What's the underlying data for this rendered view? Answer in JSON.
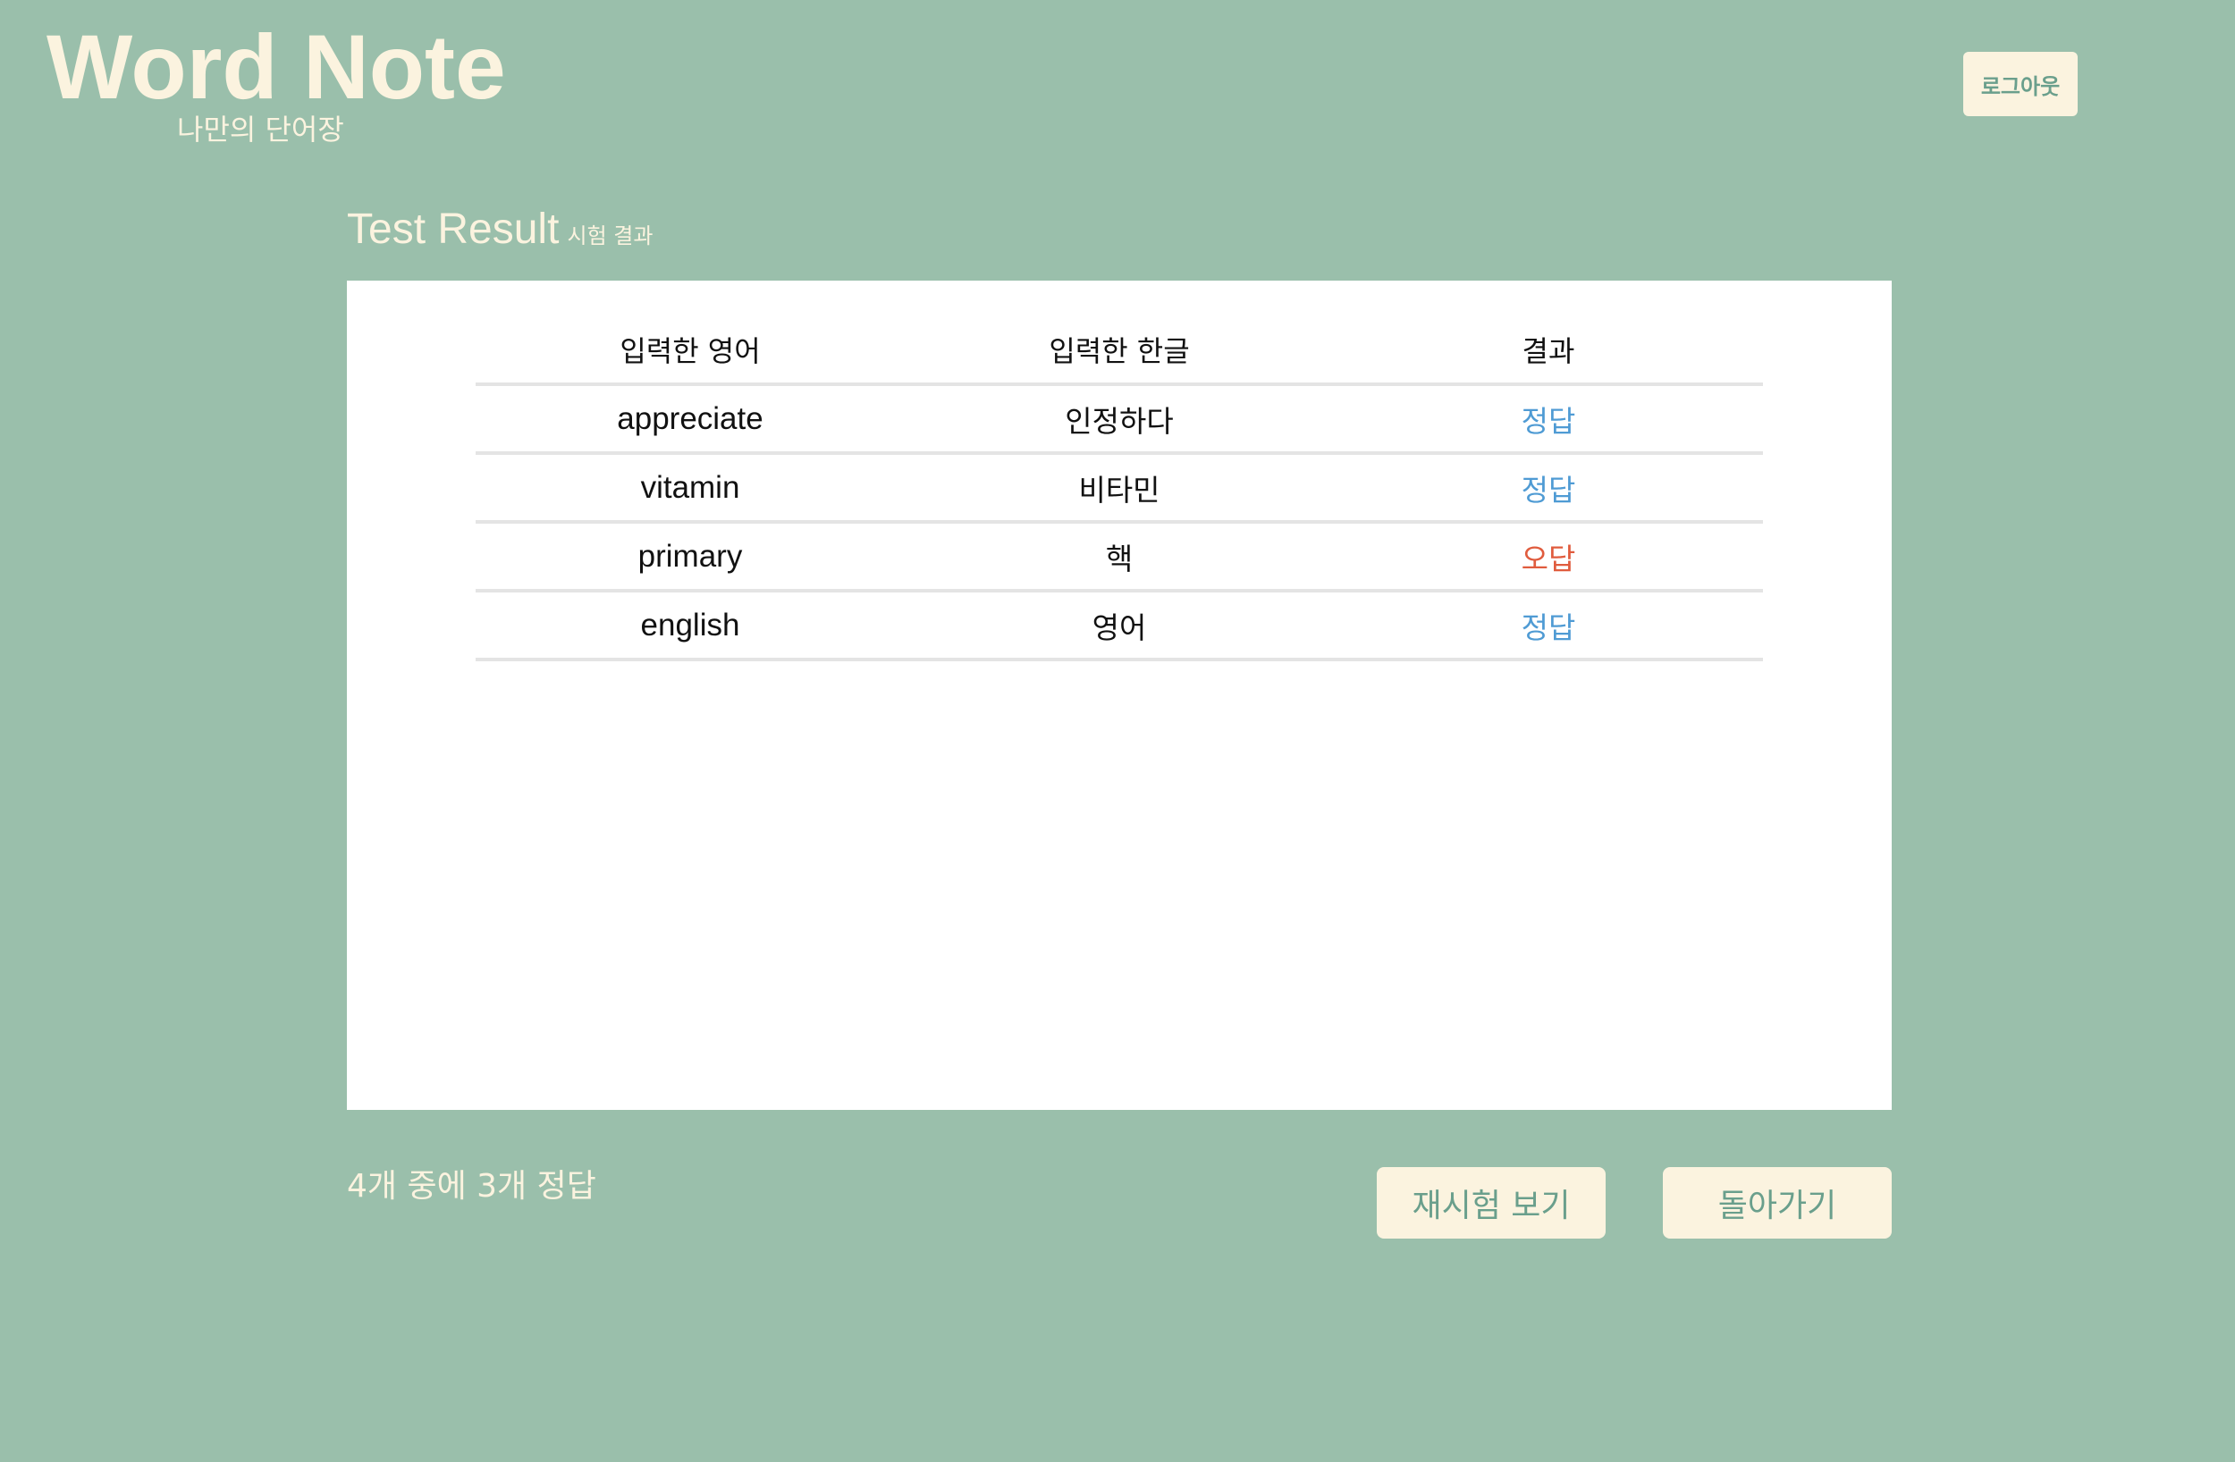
{
  "header": {
    "title": "Word Note",
    "subtitle": "나만의 단어장",
    "logout_label": "로그아웃"
  },
  "page": {
    "title": "Test Result",
    "subtitle": "시험 결과"
  },
  "table": {
    "columns": [
      "입력한 영어",
      "입력한 한글",
      "결과"
    ],
    "rows": [
      {
        "english": "appreciate",
        "korean": "인정하다",
        "result": "정답",
        "status": "correct"
      },
      {
        "english": "vitamin",
        "korean": "비타민",
        "result": "정답",
        "status": "correct"
      },
      {
        "english": "primary",
        "korean": "핵",
        "result": "오답",
        "status": "wrong"
      },
      {
        "english": "english",
        "korean": "영어",
        "result": "정답",
        "status": "correct"
      }
    ]
  },
  "summary": {
    "text": "4개 중에 3개 정답"
  },
  "actions": {
    "retest_label": "재시험 보기",
    "back_label": "돌아가기"
  },
  "colors": {
    "background": "#9abfab",
    "cream": "#fbf3df",
    "button_text": "#6a9f8c",
    "correct": "#4f9bd4",
    "wrong": "#e05c3e"
  }
}
